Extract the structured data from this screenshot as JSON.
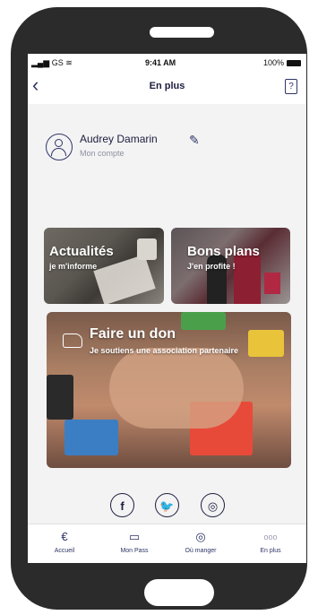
{
  "status_bar": {
    "carrier": "GS",
    "time": "9:41 AM",
    "battery": "100%"
  },
  "header": {
    "title": "En plus",
    "back_icon": "chevron-left-icon",
    "help_icon": "help-icon",
    "help_glyph": "?"
  },
  "profile": {
    "name": "Audrey Damarin",
    "subtitle": "Mon compte",
    "edit_icon": "pencil-icon"
  },
  "cards": {
    "actualites": {
      "title": "Actualités",
      "subtitle": "je m'informe"
    },
    "bons_plans": {
      "title": "Bons plans",
      "subtitle": "J'en profite !"
    },
    "don": {
      "title": "Faire un don",
      "subtitle": "Je soutiens une association partenaire"
    }
  },
  "socials": [
    {
      "name": "facebook-icon",
      "glyph": "f"
    },
    {
      "name": "twitter-icon",
      "glyph": "🐦"
    },
    {
      "name": "instagram-icon",
      "glyph": "◎"
    }
  ],
  "tabs": [
    {
      "label": "Accueil",
      "icon": "home-euro-icon",
      "glyph": "€"
    },
    {
      "label": "Mon Pass",
      "icon": "card-icon",
      "glyph": "▭"
    },
    {
      "label": "Où manger",
      "icon": "dish-icon",
      "glyph": "◎"
    },
    {
      "label": "En plus",
      "icon": "more-icon",
      "glyph": "ooo"
    }
  ]
}
